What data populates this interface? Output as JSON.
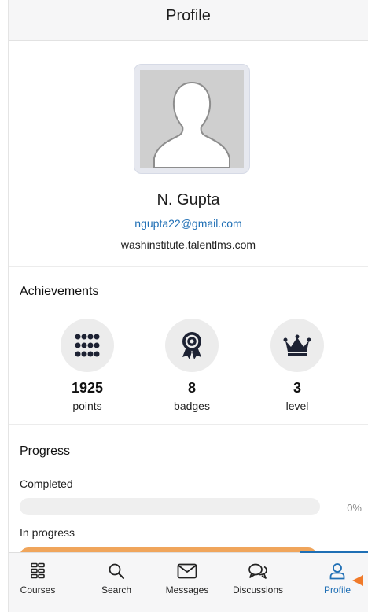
{
  "header": {
    "title": "Profile"
  },
  "profile": {
    "name": "N. Gupta",
    "email": "ngupta22@gmail.com",
    "domain": "washinstitute.talentlms.com"
  },
  "achievements": {
    "title": "Achievements",
    "items": [
      {
        "icon": "dots-grid-icon",
        "value": "1925",
        "label": "points"
      },
      {
        "icon": "badge-award-icon",
        "value": "8",
        "label": "badges"
      },
      {
        "icon": "crown-icon",
        "value": "3",
        "label": "level"
      }
    ]
  },
  "progress": {
    "title": "Progress",
    "completed": {
      "label": "Completed",
      "percent_text": "0%",
      "fraction": 0.0
    },
    "in_progress": {
      "label": "In progress",
      "fraction": 1.0
    }
  },
  "tabs": [
    {
      "label": "Courses",
      "icon": "courses-grid-icon",
      "active": false
    },
    {
      "label": "Search",
      "icon": "search-icon",
      "active": false
    },
    {
      "label": "Messages",
      "icon": "envelope-icon",
      "active": false
    },
    {
      "label": "Discussions",
      "icon": "chat-bubbles-icon",
      "active": false
    },
    {
      "label": "Profile",
      "icon": "user-icon",
      "active": true
    }
  ],
  "colors": {
    "link": "#1f6fb5",
    "active_tab": "#1f6fb5",
    "progress_fill": "#f0a55b",
    "pointer": "#f07a2a"
  }
}
